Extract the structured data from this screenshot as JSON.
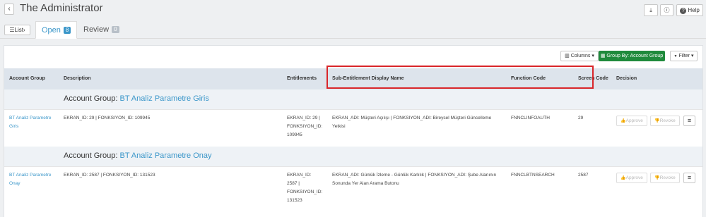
{
  "header": {
    "back_icon": "‹",
    "title": "The Administrator",
    "download_icon": "⤓",
    "info_icon": "ⓘ",
    "help_icon": "?",
    "help_label": "Help"
  },
  "tabs": {
    "list_icon": "☰",
    "list_label": "List",
    "list_chevron": "›",
    "open_label": "Open",
    "open_count": "8",
    "review_label": "Review",
    "review_count": "0"
  },
  "toolbar": {
    "columns_label": "Columns",
    "columns_icon": "▥",
    "group_by_label": "Group By: Account Group",
    "group_by_icon": "▦",
    "filter_label": "Filter",
    "filter_icon": "▼",
    "chevron_icon": "▾"
  },
  "table": {
    "headers": {
      "account_group": "Account Group",
      "description": "Description",
      "entitlements": "Entitlements",
      "sub_entitlement": "Sub-Entitlement Display Name",
      "function_code": "Function Code",
      "screen_code": "Screen Code",
      "decision": "Decision"
    },
    "groups": [
      {
        "label": "Account Group: ",
        "name": "BT Analiz Parametre Giris",
        "row": {
          "account_group_line1": "BT Analiz Parametre",
          "account_group_line2": "Giris",
          "description": "EKRAN_ID: 29 | FONKSIYON_ID: 109945",
          "entitlements_line1": "EKRAN_ID: 29 |",
          "entitlements_line2": "FONKSIYON_ID:",
          "entitlements_line3": "109945",
          "sub_line1": "EKRAN_ADI: Müşteri Açılışı | FONKSIYON_ADI: Bireysel Müşteri Güncelleme",
          "sub_line2": "Yetkisi",
          "function_code": "FNNCLINFOAUTH",
          "screen_code": "29",
          "approve_label": "Approve",
          "revoke_label": "Revoke"
        }
      },
      {
        "label": "Account Group: ",
        "name": "BT Analiz Parametre Onay",
        "row": {
          "account_group_line1": "BT Analiz Parametre",
          "account_group_line2": "Onay",
          "description": "EKRAN_ID: 2587 | FONKSIYON_ID: 131523",
          "entitlements_line1": "EKRAN_ID:",
          "entitlements_line2": "2587 |",
          "entitlements_line3": "FONKSIYON_ID:",
          "entitlements_line4": "131523",
          "sub_line1": "EKRAN_ADI: Günlük İzleme - Günlük Karlılık | FONKSIYON_ADI: Şube Alanının",
          "sub_line2": "Sonunda Yer Alan Arama Butonu",
          "function_code": "FNNCLBTNSEARCH",
          "screen_code": "2587",
          "approve_label": "Approve",
          "revoke_label": "Revoke"
        }
      }
    ],
    "thumbs_up_icon": "👍",
    "thumbs_down_icon": "👎",
    "menu_icon": "≡"
  },
  "colors": {
    "accent": "#3a96c9",
    "group_by_button": "#1f8a3c",
    "highlight": "#d9262a",
    "header_bg": "#dde4ec"
  }
}
